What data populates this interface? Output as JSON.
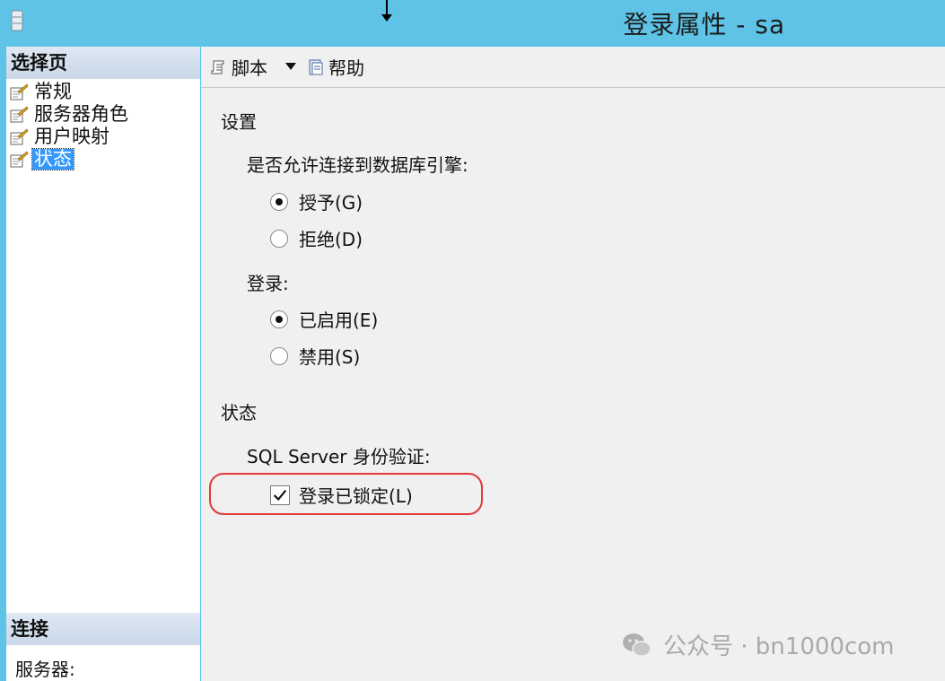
{
  "window": {
    "title": "登录属性 - sa"
  },
  "left_pane": {
    "select_page_header": "选择页",
    "pages": [
      {
        "label": "常规",
        "selected": false
      },
      {
        "label": "服务器角色",
        "selected": false
      },
      {
        "label": "用户映射",
        "selected": false
      },
      {
        "label": "状态",
        "selected": true
      }
    ],
    "connection_header": "连接",
    "server_label": "服务器:"
  },
  "toolbar": {
    "script_label": "脚本",
    "help_label": "帮助"
  },
  "settings": {
    "title": "设置",
    "db_engine_label": "是否允许连接到数据库引擎:",
    "grant_label": "授予(G)",
    "deny_label": "拒绝(D)",
    "grant_selected": true,
    "login_label": "登录:",
    "enabled_label": "已启用(E)",
    "disabled_label": "禁用(S)",
    "enabled_selected": true
  },
  "status": {
    "title": "状态",
    "auth_label": "SQL Server 身份验证:",
    "locked_label": "登录已锁定(L)",
    "locked_checked": true
  },
  "watermark": {
    "text": "公众号 · bn1000com"
  },
  "colors": {
    "title_bar": "#5ec3e6",
    "selection": "#3399ff",
    "highlight": "#e03a3a"
  }
}
